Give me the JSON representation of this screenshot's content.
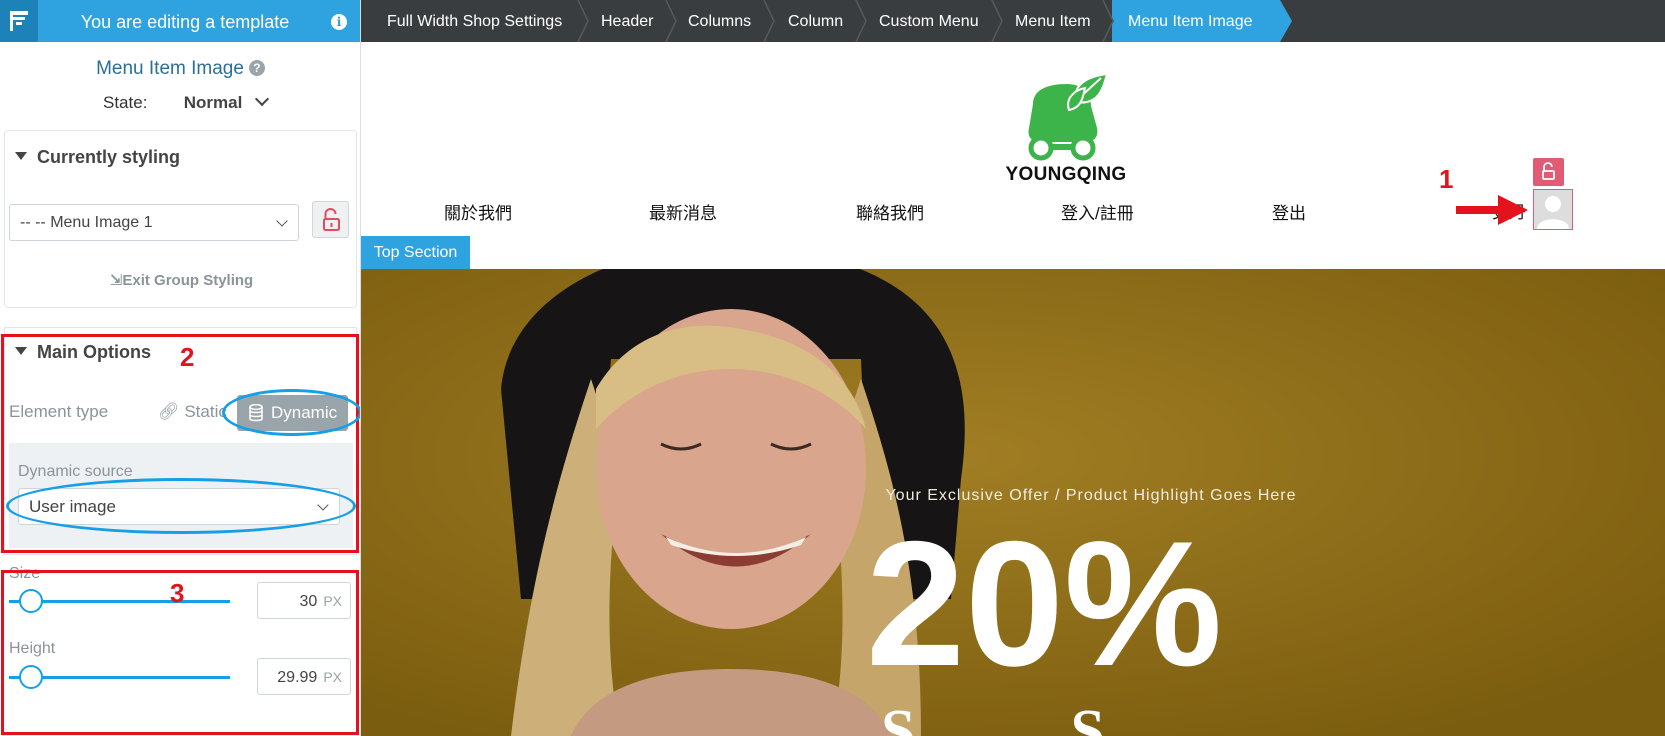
{
  "editor": {
    "banner": "You are editing a template",
    "panel_title": "Menu Item Image",
    "state_label": "State:",
    "state_value": "Normal"
  },
  "styling": {
    "header": "Currently styling",
    "selected": "-- -- Menu Image 1",
    "exit_label": "Exit Group Styling"
  },
  "main_options": {
    "header": "Main Options",
    "element_type_label": "Element type",
    "static_label": "Static",
    "dynamic_label": "Dynamic",
    "dynamic_source_label": "Dynamic source",
    "dynamic_source_value": "User image"
  },
  "dimensions": {
    "size_label": "Size",
    "size_value": "30",
    "height_label": "Height",
    "height_value": "29.99",
    "unit": "PX"
  },
  "annotations": {
    "label_1": "1",
    "label_2": "2",
    "label_3": "3",
    "color": "#e3121d",
    "ellipse_color": "#169fe6"
  },
  "breadcrumb": [
    "Full Width Shop Settings",
    "Header",
    "Columns",
    "Column",
    "Custom Menu",
    "Menu Item",
    "Menu Item Image"
  ],
  "site": {
    "logo_text": "YOUNGQING",
    "nav": [
      "關於我們",
      "最新消息",
      "聯絡我們",
      "登入/註冊",
      "登出"
    ],
    "user_name": "史丹",
    "section_tag": "Top Section",
    "hero_tagline": "Your Exclusive Offer / Product Highlight Goes Here",
    "hero_big": "20%"
  },
  "colors": {
    "accent": "#2ea3e0",
    "breadcrumb_bg": "#3a3d40",
    "hero_bg": "#8d6b12",
    "brand_green": "#3db44a"
  }
}
